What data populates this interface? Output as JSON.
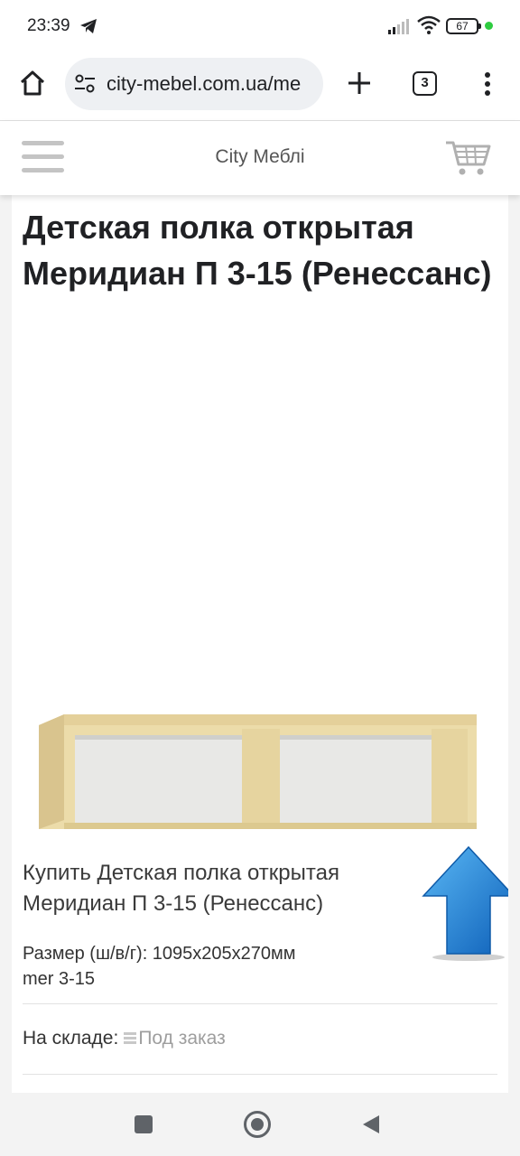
{
  "status_bar": {
    "time": "23:39",
    "battery": "67",
    "icons": [
      "telegram-icon",
      "signal-icon",
      "wifi-icon",
      "battery-icon"
    ]
  },
  "browser": {
    "url": "city-mebel.com.ua/me",
    "tab_count": "3"
  },
  "site": {
    "title": "City Меблі"
  },
  "product": {
    "title": "Детская полка открытая Меридиан П 3-15 (Ренессанс)",
    "buy_text": "Купить Детская полка открытая Меридиан П 3-15 (Ренессанс)",
    "size_line": "Размер (ш/в/г): 1095x205x270мм",
    "code_line": "mer 3-15",
    "stock_label": "На складе:",
    "stock_value": "Под заказ",
    "colors": {
      "wood": "#ecdcaa",
      "back_panel": "#e8e8e6",
      "arrow": "#1e7fd6"
    }
  }
}
